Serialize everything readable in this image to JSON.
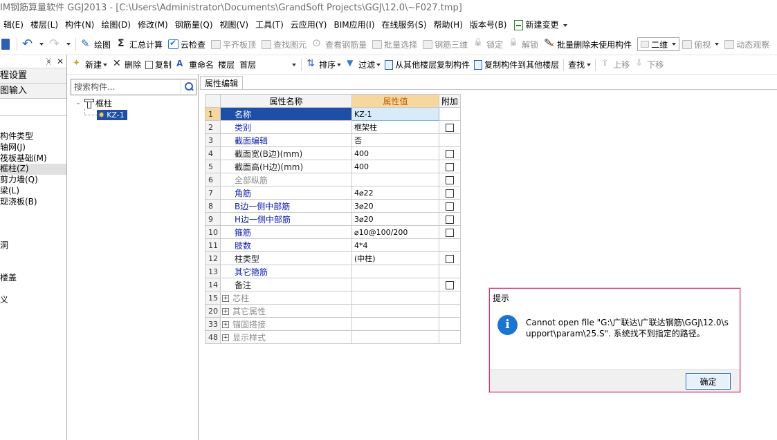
{
  "window": {
    "title": "IM钢筋算量软件 GGJ2013 - [C:\\Users\\Administrator\\Documents\\GrandSoft Projects\\GGJ\\12.0\\~F027.tmp]"
  },
  "menu": {
    "items": [
      "辑(E)",
      "楼层(L)",
      "构件(N)",
      "绘图(D)",
      "修改(M)",
      "钢筋量(Q)",
      "视图(V)",
      "工具(T)",
      "云应用(Y)",
      "BIM应用(I)",
      "在线服务(S)",
      "帮助(H)",
      "版本号(B)"
    ],
    "new_change": "新建变更"
  },
  "toolbar": {
    "draw": "绘图",
    "summary": "汇总计算",
    "cloud_check": "云检查",
    "level_slab": "平齐板顶",
    "find_element": "查找图元",
    "view_rebar": "查看钢筋量",
    "batch_select": "批量选择",
    "rebar_3d": "钢筋三维",
    "lock": "锁定",
    "unlock": "解锁",
    "batch_delete": "批量删除未使用构件",
    "view_mode": "二维",
    "top_view": "俯视",
    "dynamic_view": "动态观察"
  },
  "toolbar2": {
    "new": "新建",
    "delete": "删除",
    "copy": "复制",
    "rename": "重命名",
    "floor_label": "楼层",
    "floor_value": "首层",
    "sort": "排序",
    "filter": "过滤",
    "copy_from_other": "从其他楼层复制构件",
    "copy_to_other": "复制构件到其他楼层",
    "find": "查找",
    "up": "上移",
    "down": "下移"
  },
  "left_panel": {
    "pin": "ᚸ",
    "close": "✕",
    "items": [
      "程设置",
      "图输入"
    ],
    "tree": [
      "构件类型",
      "轴网(J)",
      "筏板基础(M)",
      "框柱(Z)",
      "剪力墙(Q)",
      "梁(L)",
      "现浇板(B)",
      "",
      "",
      "",
      "洞",
      "",
      "",
      "楼盖",
      "",
      "义"
    ]
  },
  "component_list": {
    "search_placeholder": "搜索构件...",
    "root": "框柱",
    "child": "KZ-1"
  },
  "property_editor": {
    "tab": "属性编辑",
    "headers": {
      "name": "属性名称",
      "value": "属性值",
      "extra": "附加"
    },
    "rows": [
      {
        "num": "1",
        "name": "名称",
        "value": "KZ-1",
        "style": "selrow",
        "check": false
      },
      {
        "num": "2",
        "name": "类别",
        "value": "框架柱",
        "style": "blue",
        "check": true
      },
      {
        "num": "3",
        "name": "截面编辑",
        "value": "否",
        "style": "blue",
        "check": false
      },
      {
        "num": "4",
        "name": "截面宽(B边)(mm)",
        "value": "400",
        "style": "black",
        "check": true
      },
      {
        "num": "5",
        "name": "截面高(H边)(mm)",
        "value": "400",
        "style": "black",
        "check": true
      },
      {
        "num": "6",
        "name": "全部纵筋",
        "value": "",
        "style": "grey",
        "check": true
      },
      {
        "num": "7",
        "name": "角筋",
        "value": "4⌀22",
        "style": "blue",
        "check": true
      },
      {
        "num": "8",
        "name": "B边一侧中部筋",
        "value": "3⌀20",
        "style": "blue",
        "check": true
      },
      {
        "num": "9",
        "name": "H边一侧中部筋",
        "value": "3⌀20",
        "style": "blue",
        "check": true
      },
      {
        "num": "10",
        "name": "箍筋",
        "value": "⌀10@100/200",
        "style": "blue",
        "check": true
      },
      {
        "num": "11",
        "name": "肢数",
        "value": "4*4",
        "style": "blue",
        "check": false
      },
      {
        "num": "12",
        "name": "柱类型",
        "value": "(中柱)",
        "style": "black",
        "check": true
      },
      {
        "num": "13",
        "name": "其它箍筋",
        "value": "",
        "style": "blue",
        "check": false
      },
      {
        "num": "14",
        "name": "备注",
        "value": "",
        "style": "black",
        "check": true
      },
      {
        "num": "15",
        "name": "芯柱",
        "value": "",
        "style": "exp",
        "check": false
      },
      {
        "num": "20",
        "name": "其它属性",
        "value": "",
        "style": "exp",
        "check": false
      },
      {
        "num": "33",
        "name": "锚固搭接",
        "value": "",
        "style": "exp",
        "check": false
      },
      {
        "num": "48",
        "name": "显示样式",
        "value": "",
        "style": "exp",
        "check": false
      }
    ]
  },
  "dialog": {
    "title": "提示",
    "message": "Cannot open file \"G:\\广联达\\广联达钢筋\\GGJ\\12.0\\support\\param\\25.S\". 系统找不到指定的路径。",
    "ok": "确定"
  },
  "colors": {
    "accent": "#1e4fa8",
    "header_value": "#f7d7a0",
    "dialog_border": "#d6336c",
    "info_icon": "#1a75d1"
  }
}
